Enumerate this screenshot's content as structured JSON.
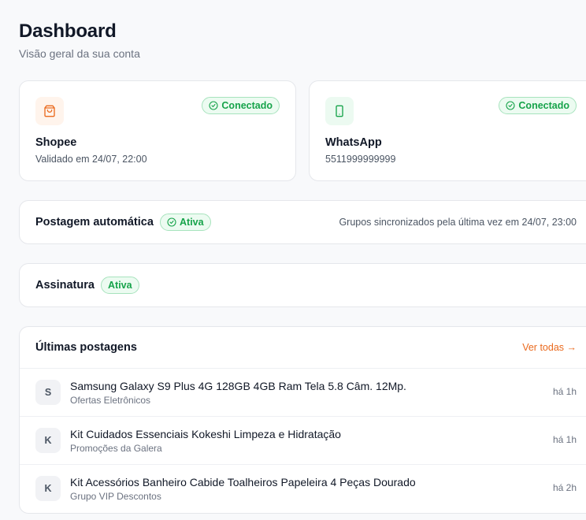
{
  "header": {
    "title": "Dashboard",
    "subtitle": "Visão geral da sua conta"
  },
  "integrations": {
    "shopee": {
      "icon": "shopping-bag-icon",
      "name": "Shopee",
      "detail": "Validado em 24/07, 22:00",
      "status": "Conectado"
    },
    "whatsapp": {
      "icon": "smartphone-icon",
      "name": "WhatsApp",
      "detail": "5511999999999",
      "status": "Conectado"
    }
  },
  "auto_posting": {
    "title": "Postagem automática",
    "status": "Ativa",
    "sync_text": "Grupos sincronizados pela última vez em 24/07, 23:00"
  },
  "subscription": {
    "title": "Assinatura",
    "status": "Ativa"
  },
  "recent_posts": {
    "title": "Últimas postagens",
    "see_all": "Ver todas →",
    "items": [
      {
        "initial": "S",
        "title": "Samsung Galaxy S9 Plus 4G 128GB 4GB Ram Tela 5.8 Câm. 12Mp.",
        "group": "Ofertas Eletrônicos",
        "time": "há 1h"
      },
      {
        "initial": "K",
        "title": "Kit Cuidados Essenciais Kokeshi Limpeza e Hidratação",
        "group": "Promoções da Galera",
        "time": "há 1h"
      },
      {
        "initial": "K",
        "title": "Kit Acessórios Banheiro Cabide Toalheiros Papeleira 4 Peças Dourado",
        "group": "Grupo VIP Descontos",
        "time": "há 2h"
      }
    ]
  },
  "colors": {
    "accent": "#ea6a1e",
    "success": "#16a34a",
    "border": "#e5e7eb",
    "background": "#f8f9fb"
  }
}
